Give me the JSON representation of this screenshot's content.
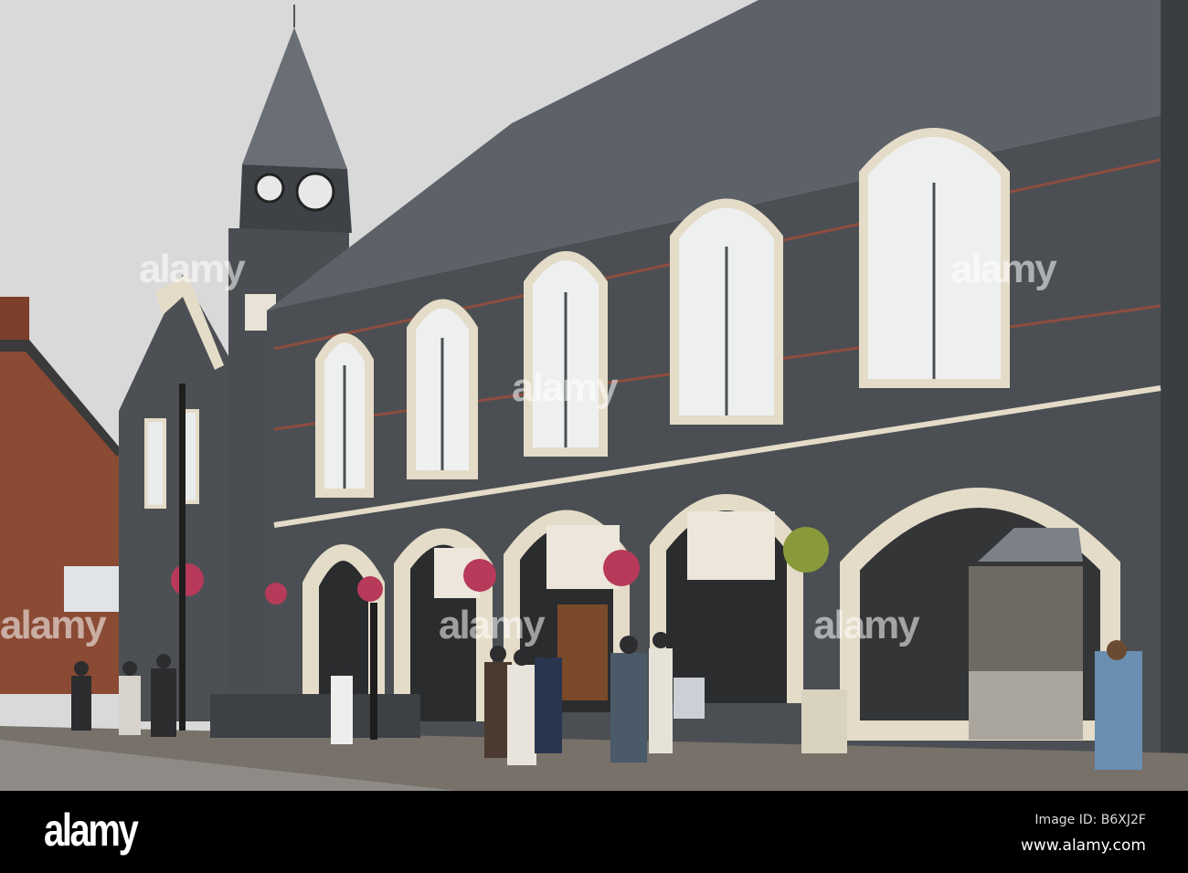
{
  "watermarks": [
    "alamy",
    "alamy",
    "alamy",
    "alamy",
    "alamy",
    "alamy"
  ],
  "footer": {
    "logo": "alamy",
    "image_id": "Image ID: B6XJ2F",
    "site": "www.alamy.com"
  },
  "colors": {
    "sky": "#d9d9d9",
    "slate": "#4b4f53",
    "stone": "#e4dcc8",
    "roof": "#5d6268",
    "brick": "#8a4a33",
    "pavement": "#77716a"
  }
}
